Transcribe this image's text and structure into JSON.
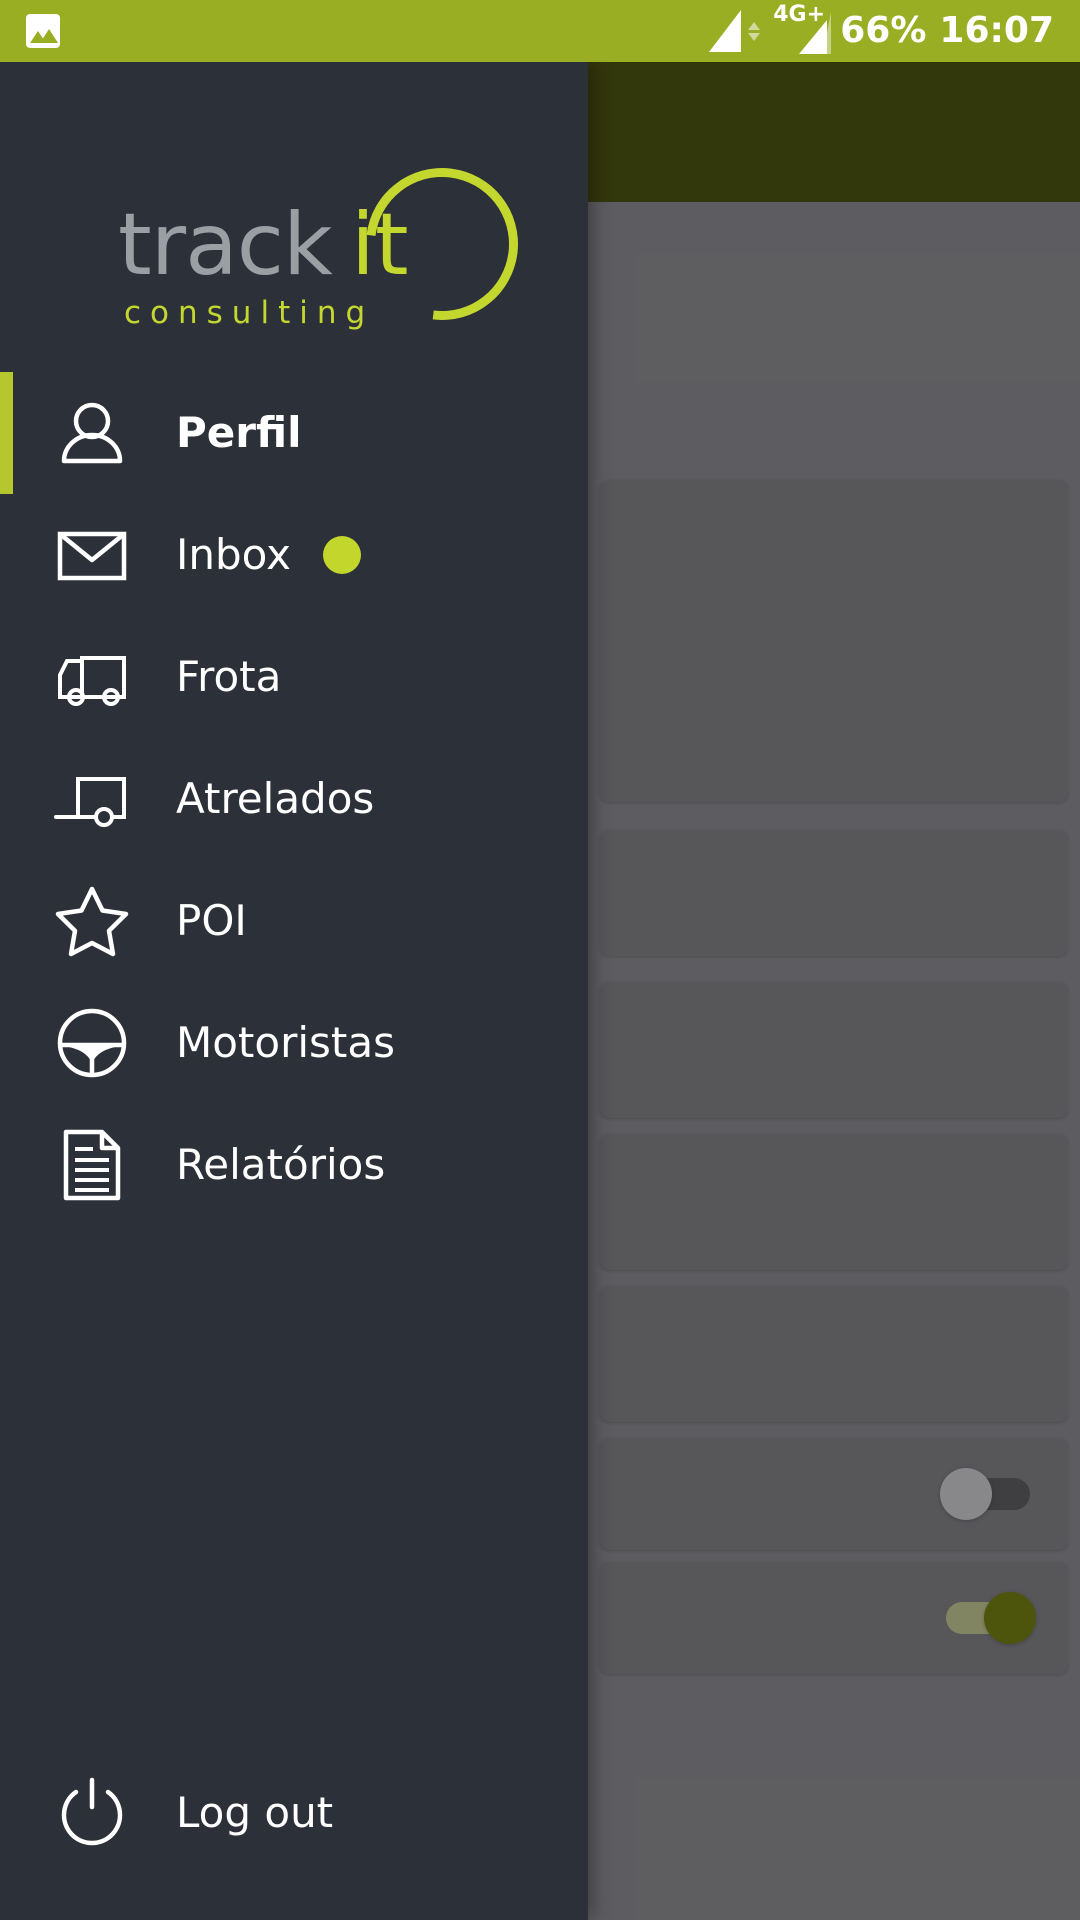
{
  "status_bar": {
    "background_color": "#9aae23",
    "left_icons": [
      {
        "name": "image-icon",
        "label": ""
      }
    ],
    "network_label": "4G+",
    "battery_percent": "66%",
    "time": "16:07"
  },
  "drawer": {
    "background_color": "#2c3039",
    "accent_color": "#c4d72e",
    "logo": {
      "word_primary": "track",
      "word_accent": "it",
      "subtitle": "consulting",
      "primary_color": "#9b9ea3",
      "accent_color": "#c4d72e"
    },
    "items": [
      {
        "label": "Perfil",
        "icon": "person-icon",
        "active": true,
        "badge": false
      },
      {
        "label": "Inbox",
        "icon": "envelope-icon",
        "active": false,
        "badge": true
      },
      {
        "label": "Frota",
        "icon": "truck-icon",
        "active": false,
        "badge": false
      },
      {
        "label": "Atrelados",
        "icon": "trailer-icon",
        "active": false,
        "badge": false
      },
      {
        "label": "POI",
        "icon": "star-icon",
        "active": false,
        "badge": false
      },
      {
        "label": "Motoristas",
        "icon": "steering-wheel-icon",
        "active": false,
        "badge": false
      },
      {
        "label": "Relatórios",
        "icon": "document-icon",
        "active": false,
        "badge": false
      }
    ],
    "logout": {
      "label": "Log out",
      "icon": "power-icon"
    },
    "badge_color": "#c2d62b",
    "active_indicator_color": "#b5c72d"
  },
  "background_app": {
    "appbar_color": "#4a4f12",
    "surface_color": "#86868b",
    "card_color": "#7d7d82",
    "toggles": [
      {
        "state": "off",
        "track_color": "#5b5b5f",
        "knob_color": "#c3c3c6"
      },
      {
        "state": "on",
        "track_color": "#b9bf8d",
        "knob_color": "#6d7a11"
      }
    ]
  }
}
